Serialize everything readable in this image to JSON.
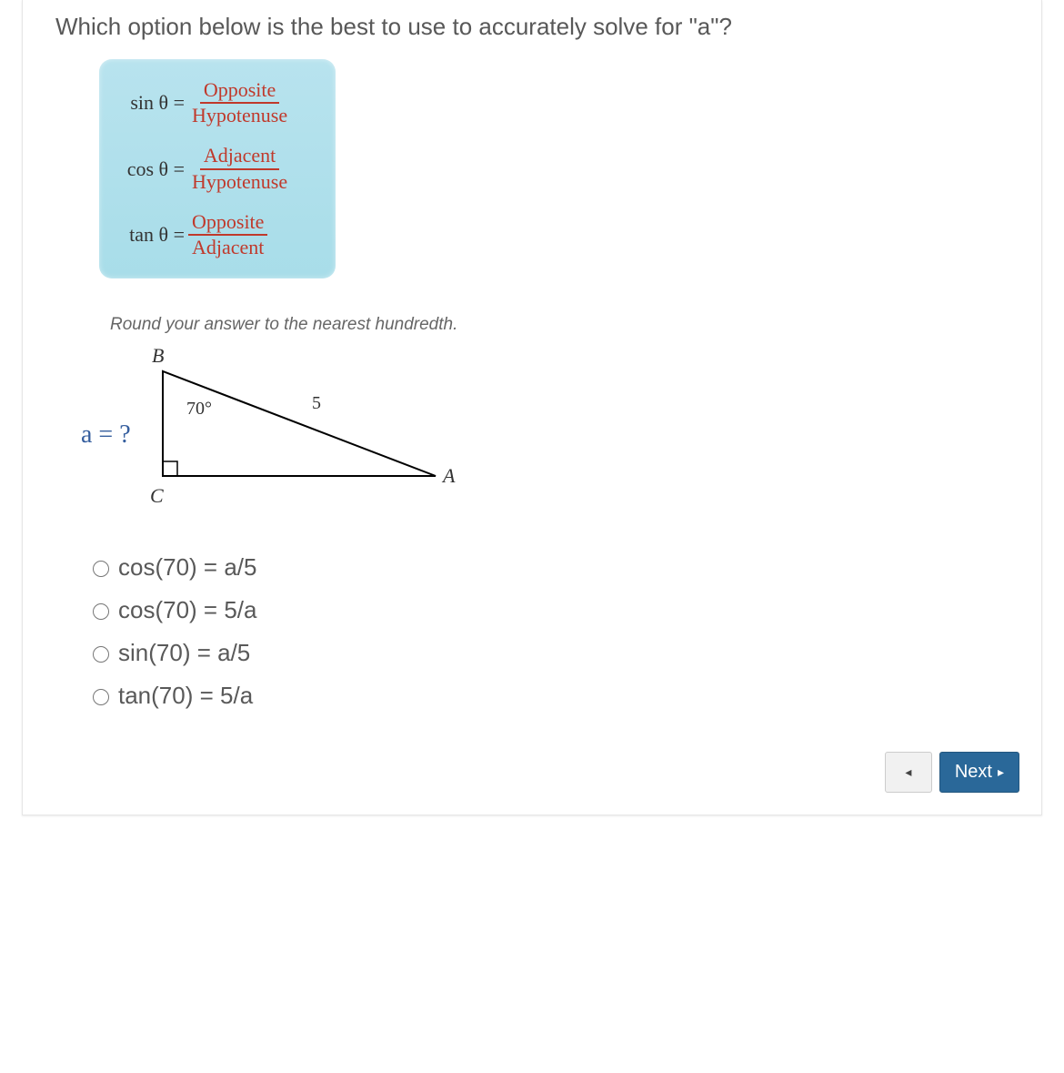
{
  "question": "Which option below is the best to use to accurately solve for \"a\"?",
  "formulas": {
    "sin": {
      "lhs": "sin θ =",
      "num": "Opposite",
      "den": "Hypotenuse"
    },
    "cos": {
      "lhs": "cos θ =",
      "num": "Adjacent",
      "den": "Hypotenuse"
    },
    "tan": {
      "lhs": "tan θ =",
      "num": "Opposite",
      "den": "Adjacent"
    }
  },
  "instruction": "Round your answer to the nearest hundredth.",
  "triangle": {
    "a_label": "a = ?",
    "vertex_b": "B",
    "vertex_c": "C",
    "vertex_a": "A",
    "angle": "70°",
    "hypotenuse": "5"
  },
  "options": [
    "cos(70) = a/5",
    "cos(70) = 5/a",
    "sin(70) = a/5",
    "tan(70) = 5/a"
  ],
  "nav": {
    "prev_glyph": "◂",
    "next_label": "Next",
    "next_glyph": "▸"
  }
}
